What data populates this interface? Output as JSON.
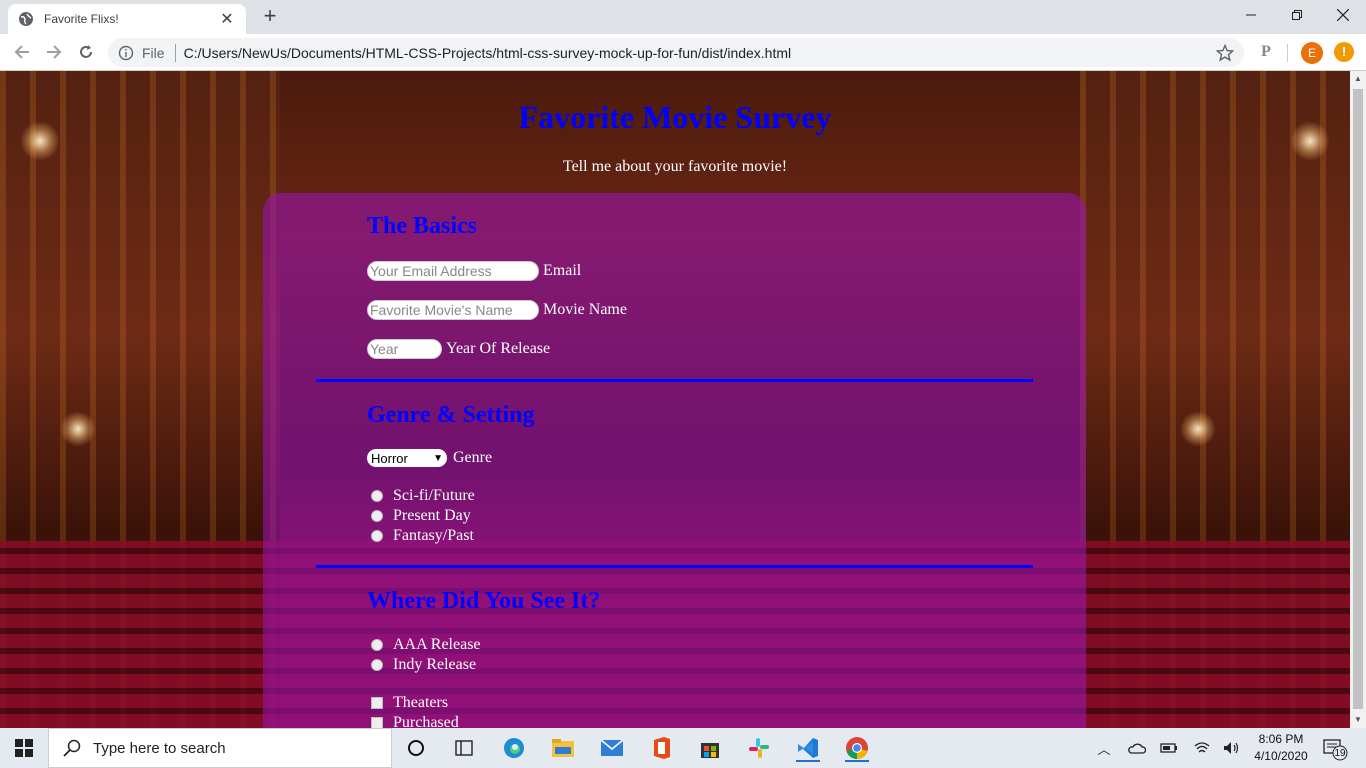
{
  "browser": {
    "tab_title": "Favorite Flixs!",
    "new_tab": "+",
    "omnibox_scheme": "File",
    "url": "C:/Users/NewUs/Documents/HTML-CSS-Projects/html-css-survey-mock-up-for-fun/dist/index.html",
    "extension_letter": "P",
    "profile_initial": "E",
    "update_badge": "!"
  },
  "page": {
    "title": "Favorite Movie Survey",
    "description": "Tell me about your favorite movie!",
    "basics": {
      "heading": "The Basics",
      "email": {
        "placeholder": "Your Email Address",
        "label": "Email"
      },
      "movie": {
        "placeholder": "Favorite Movie's Name",
        "label": "Movie Name"
      },
      "year": {
        "placeholder": "Year",
        "label": "Year Of Release"
      }
    },
    "genre": {
      "heading": "Genre & Setting",
      "select_value": "Horror",
      "select_label": "Genre",
      "settings": [
        "Sci-fi/Future",
        "Present Day",
        "Fantasy/Past"
      ]
    },
    "where": {
      "heading": "Where Did You See It?",
      "release": [
        "AAA Release",
        "Indy Release"
      ],
      "venues": [
        "Theaters",
        "Purchased"
      ]
    }
  },
  "taskbar": {
    "search_placeholder": "Type here to search",
    "time": "8:06 PM",
    "date": "4/10/2020",
    "notification_count": "19"
  }
}
